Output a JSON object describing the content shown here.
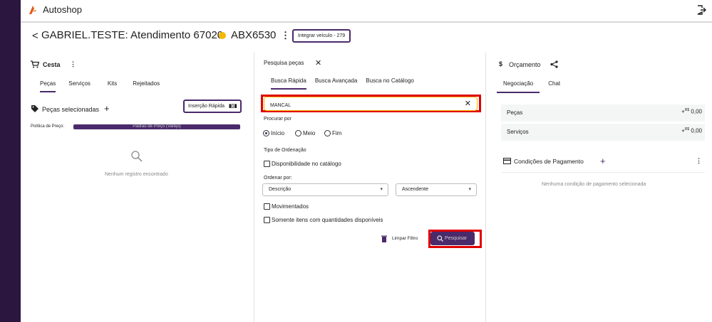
{
  "topbar": {
    "app_title": "Autoshop"
  },
  "header": {
    "back_glyph": "<",
    "title": "GABRIEL.TESTE: Atendimento 67020",
    "plate": "ABX6530",
    "status_color": "#f5b800",
    "integrar_label": "Integrar veículo - 279"
  },
  "cesta": {
    "title": "Cesta",
    "tabs": [
      "Peças",
      "Serviços",
      "Kits",
      "Rejeitados"
    ],
    "selected_title": "Peças selecionadas",
    "insercao_label": "Inserção Rápida",
    "politica_label": "Política de Preço:",
    "politica_value": "Padrão de Preço (Varejo)",
    "empty_text": "Nenhum registro encontrado"
  },
  "pesquisa": {
    "title": "Pesquisa peças",
    "tabs": [
      "Busca Rápida",
      "Busca Avançada",
      "Busca no Catálogo"
    ],
    "search_value": "MANCAL",
    "procurar_label": "Procurar por",
    "procurar_options": [
      "Início",
      "Meio",
      "Fim"
    ],
    "tipo_label": "Tipo de Ordenação",
    "disponibilidade_label": "Disponibilidade no catálogo",
    "ordenar_label": "Ordenar por:",
    "ordenar_value": "Descrição",
    "ordem_value": "Ascendente",
    "movimentados_label": "Movimentados",
    "somente_label": "Somente itens com quantidades disponíveis",
    "limpar_label": "Limpar Filtro",
    "pesquisar_label": "Pesquisar"
  },
  "orcamento": {
    "title": "Orçamento",
    "tabs": [
      "Negociação",
      "Chat"
    ],
    "rows": [
      {
        "label": "Peças",
        "currency": "R$",
        "value": "0,00"
      },
      {
        "label": "Serviços",
        "currency": "R$",
        "value": "0,00"
      }
    ],
    "condicoes_title": "Condições de Pagamento",
    "condicoes_empty": "Nenhuma condição de pagamento selecionada"
  },
  "colors": {
    "accent": "#4a2a6a",
    "sidebar": "#2b1640",
    "highlight": "#e00000"
  }
}
